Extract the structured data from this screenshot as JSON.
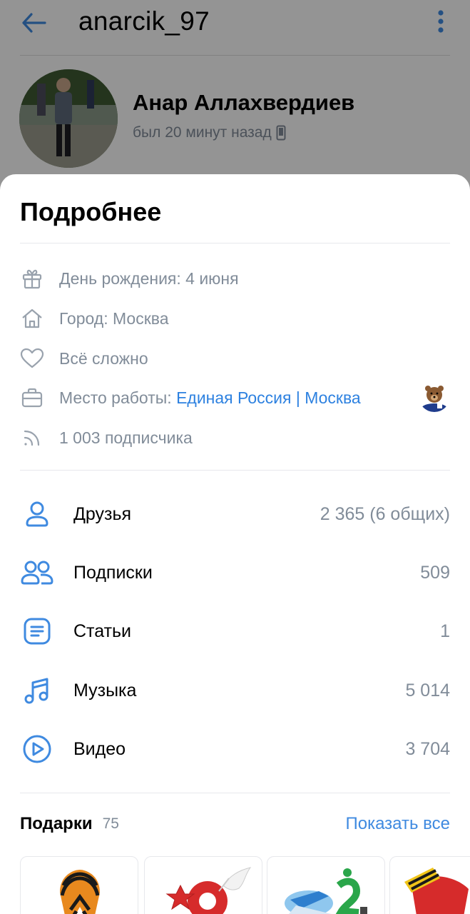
{
  "topbar": {
    "username": "anarcik_97",
    "back_icon": "arrow-left-icon",
    "more_icon": "more-vertical-icon"
  },
  "profile": {
    "name": "Анар Аллахвердиев",
    "status": "был 20 минут назад",
    "device_icon": "phone-icon"
  },
  "sheet": {
    "title": "Подробнее",
    "info": {
      "birthday": "День рождения: 4 июня",
      "city": "Город: Москва",
      "relationship": "Всё сложно",
      "work_label": "Место работы: ",
      "work_link": "Единая Россия | Москва",
      "followers": "1 003 подписчика"
    },
    "stats": [
      {
        "label": "Друзья",
        "value": "2 365 (6 общих)",
        "icon": "user-icon"
      },
      {
        "label": "Подписки",
        "value": "509",
        "icon": "users-icon"
      },
      {
        "label": "Статьи",
        "value": "1",
        "icon": "article-icon"
      },
      {
        "label": "Музыка",
        "value": "5 014",
        "icon": "music-icon"
      },
      {
        "label": "Видео",
        "value": "3 704",
        "icon": "play-circle-icon"
      }
    ],
    "gifts": {
      "title": "Подарки",
      "count": "75",
      "show_all": "Показать все"
    }
  },
  "colors": {
    "accent": "#3f8ae0",
    "link": "#2d81e0",
    "secondary_text": "#818c99",
    "icon_gray": "#99a2ad"
  }
}
